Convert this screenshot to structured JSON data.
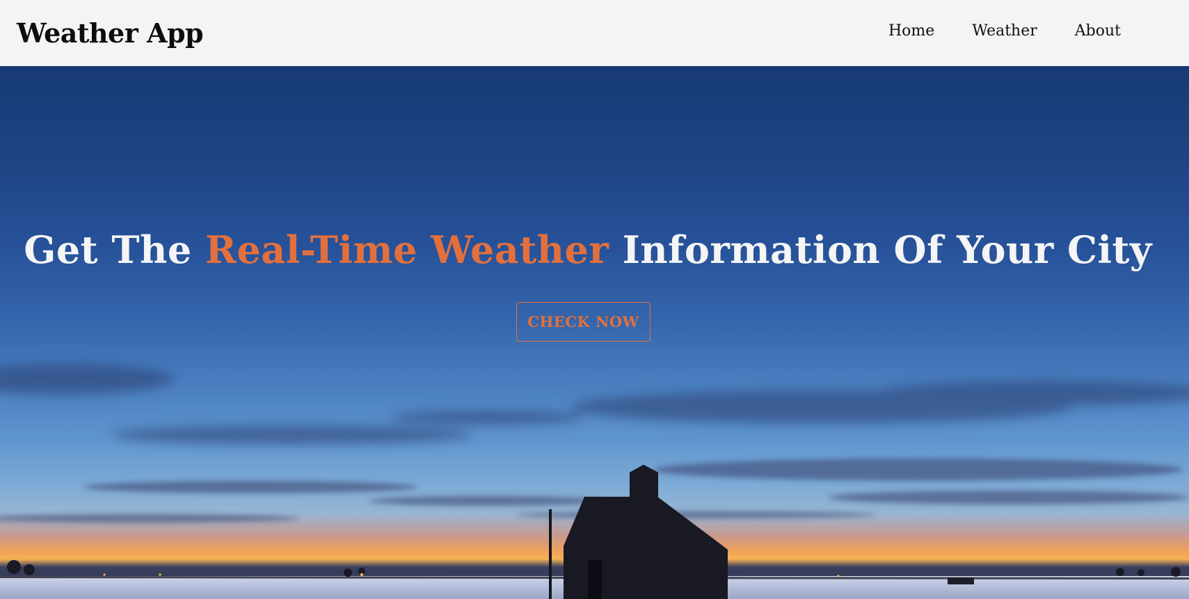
{
  "app": {
    "brand": "Weather App"
  },
  "nav": {
    "items": [
      {
        "label": "Home"
      },
      {
        "label": "Weather"
      },
      {
        "label": "About"
      }
    ]
  },
  "hero": {
    "headline_before": "Get The ",
    "headline_accent": "Real-Time Weather",
    "headline_after": " Information Of Your City",
    "cta_label": "CHECK NOW"
  },
  "colors": {
    "accent": "#e2703d",
    "navbar_bg": "#f4f4f4",
    "sky_top": "#173a74"
  }
}
